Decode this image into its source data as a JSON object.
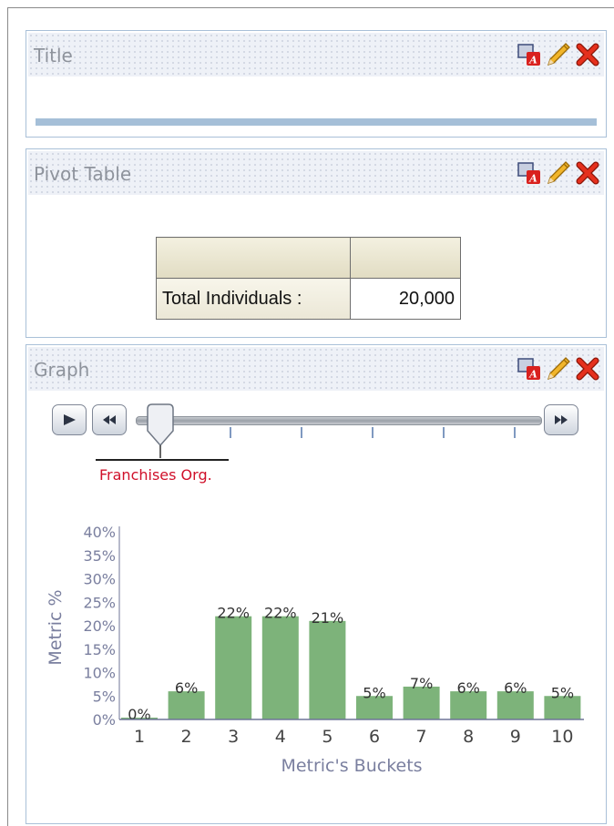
{
  "panels": {
    "title_panel": {
      "title": "Title"
    },
    "pivot_panel": {
      "title": "Pivot Table"
    },
    "graph_panel": {
      "title": "Graph"
    }
  },
  "tool_icons": [
    "format-icon",
    "edit-pencil-icon",
    "delete-x-icon"
  ],
  "pivot_table": {
    "header": [
      "",
      ""
    ],
    "rows": [
      {
        "label": "Total Individuals :",
        "value": "20,000"
      }
    ]
  },
  "slider": {
    "label": "Franchises Org.",
    "controls": [
      "play-button",
      "step-back-button",
      "step-forward-button"
    ]
  },
  "colors": {
    "bar": "#7db37a",
    "axis_text": "#7a7f9f",
    "slider_label": "#d0102a",
    "panel_border": "#a9c0d8"
  },
  "chart_data": {
    "type": "bar",
    "categories": [
      "1",
      "2",
      "3",
      "4",
      "5",
      "6",
      "7",
      "8",
      "9",
      "10"
    ],
    "values": [
      0,
      6,
      22,
      22,
      21,
      5,
      7,
      6,
      6,
      5
    ],
    "data_labels": [
      "0%",
      "6%",
      "22%",
      "22%",
      "21%",
      "5%",
      "7%",
      "6%",
      "6%",
      "5%"
    ],
    "xlabel": "Metric's Buckets",
    "ylabel": "Metric %",
    "ylim": [
      0,
      40
    ],
    "yticks": [
      "0%",
      "5%",
      "10%",
      "15%",
      "20%",
      "25%",
      "30%",
      "35%",
      "40%"
    ],
    "grid": false
  }
}
